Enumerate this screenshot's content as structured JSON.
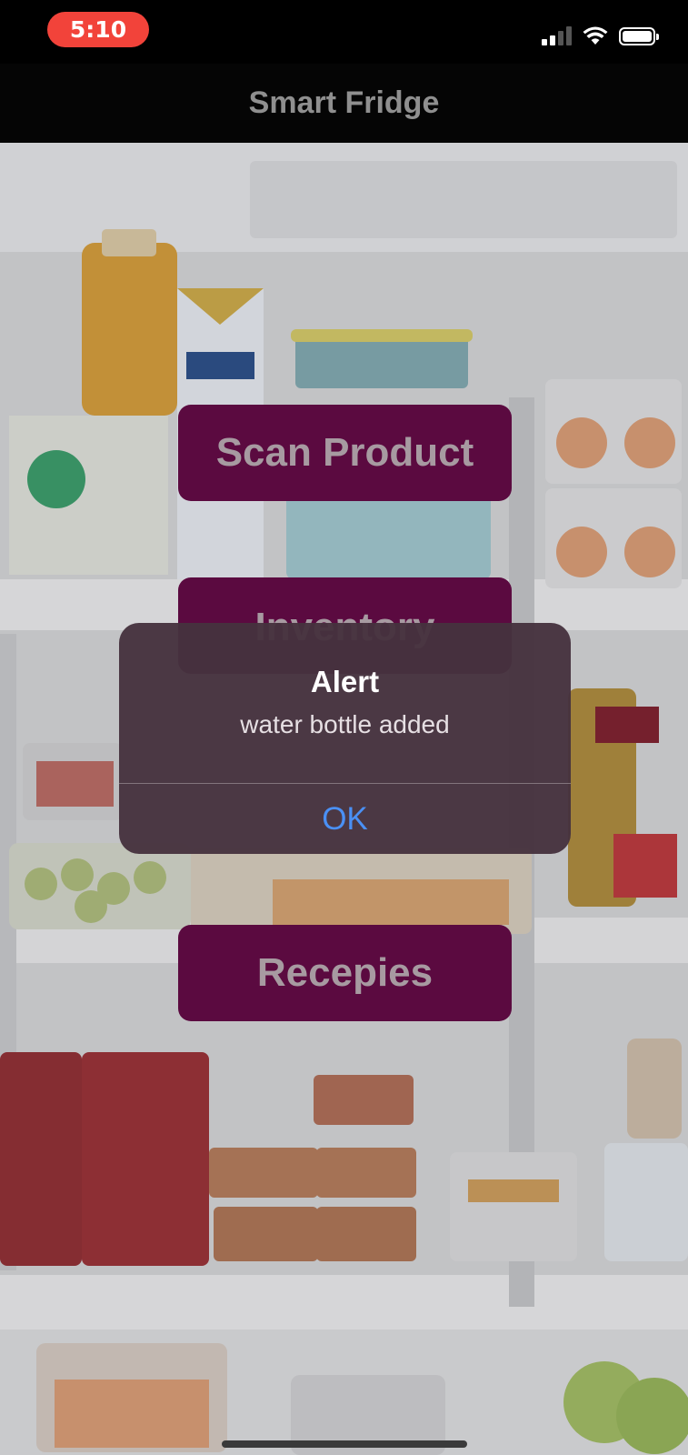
{
  "status_bar": {
    "time": "5:10",
    "time_pill_color": "#f2433a",
    "signal_icon": "cellular-signal-icon",
    "wifi_icon": "wifi-icon",
    "battery_icon": "battery-full-icon"
  },
  "nav": {
    "title": "Smart Fridge"
  },
  "menu": {
    "scan_label": "Scan Product",
    "inventory_label": "Inventory",
    "recipes_label": "Recepies",
    "button_color": "#5b0a40"
  },
  "alert": {
    "title": "Alert",
    "message": "water bottle added",
    "ok_label": "OK",
    "ok_color": "#4a90f5"
  },
  "background": {
    "image": "fridge-interior-photo"
  }
}
